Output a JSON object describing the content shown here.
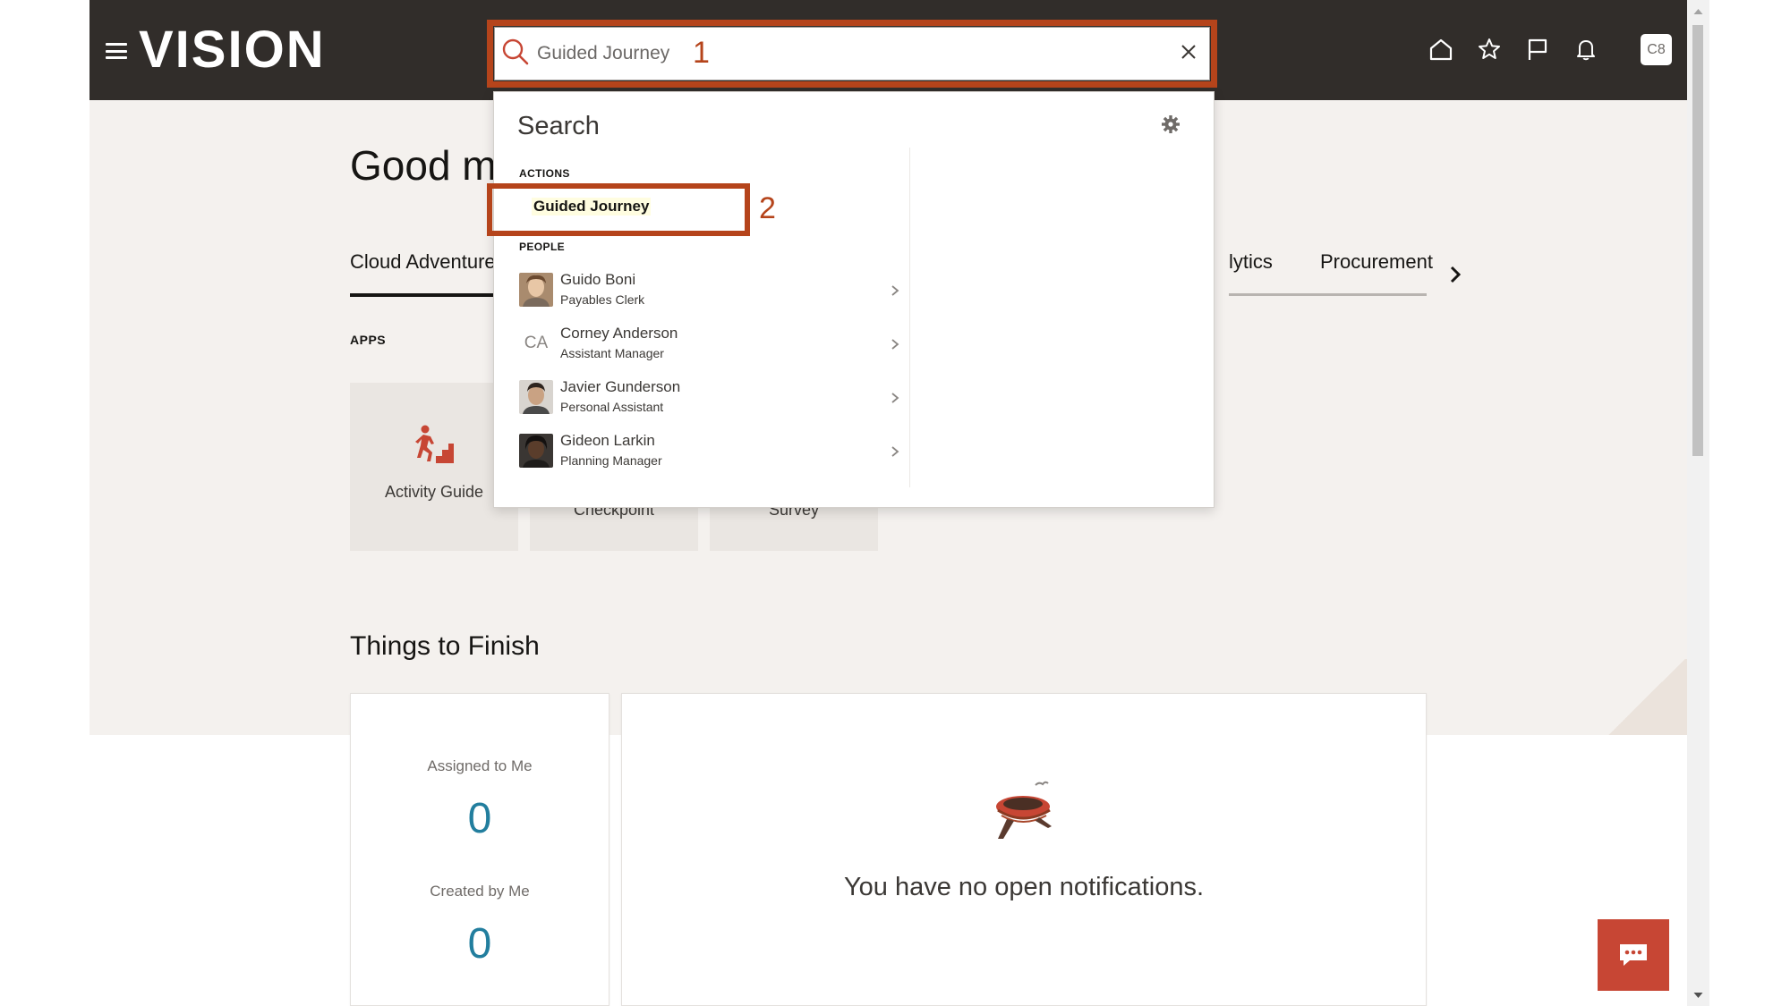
{
  "header": {
    "brand": "VISION",
    "avatar_initials": "C8",
    "icons": [
      "home-icon",
      "star-icon",
      "flag-icon",
      "bell-icon"
    ]
  },
  "search": {
    "value": "Guided Journey",
    "step_label": "1"
  },
  "greeting": "Good m",
  "tabs": [
    {
      "label": "Cloud Adventure",
      "active": true
    },
    {
      "label": "lytics",
      "active": false
    },
    {
      "label": "Procurement",
      "active": false
    }
  ],
  "apps": {
    "label": "APPS",
    "tiles": [
      {
        "label": "Activity Guide"
      },
      {
        "label": "Checkpoint"
      },
      {
        "label": "Survey"
      }
    ]
  },
  "things_to_finish": {
    "title": "Things to Finish",
    "assigned_label": "Assigned to Me",
    "assigned_count": "0",
    "created_label": "Created by Me",
    "created_count": "0",
    "empty_message": "You have no open notifications."
  },
  "dropdown": {
    "title": "Search",
    "actions_header": "ACTIONS",
    "action_item": "Guided Journey",
    "action_step_label": "2",
    "people_header": "PEOPLE",
    "people": [
      {
        "name": "Guido Boni",
        "title": "Payables Clerk",
        "initials": ""
      },
      {
        "name": "Corney Anderson",
        "title": "Assistant Manager",
        "initials": "CA"
      },
      {
        "name": "Javier Gunderson",
        "title": "Personal Assistant",
        "initials": ""
      },
      {
        "name": "Gideon Larkin",
        "title": "Planning Manager",
        "initials": ""
      }
    ]
  },
  "colors": {
    "header_bg": "#312d2a",
    "annotation": "#b5441b",
    "accent_link": "#227e9e",
    "chat_button": "#c74634"
  }
}
